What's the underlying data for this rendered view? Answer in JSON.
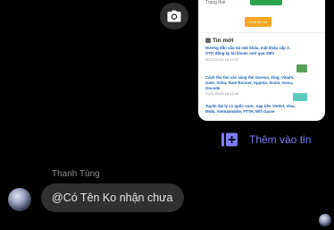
{
  "camera": {
    "icon": "camera-icon"
  },
  "preview": {
    "top_label": "Trạng thái",
    "button_label": "Xuất lịch sử",
    "heading": "Tin mới",
    "items": [
      {
        "title": "Hướng dẫn cấu tài mật khẩu, mật khẩu cấp 2, OTP, đăng ký tài khoản mới qua SMS",
        "date": "2023-03-09 15:12:07"
      },
      {
        "title": "Cách thủ tìm các sàng thẻ Garena, Zing, Vinahi, Gate, Sohu, Rate Runner, Appota, Scoin, Gosu, Oncode",
        "date": "2023-03-09 15:12:06"
      },
      {
        "title": "Tuyển đại lý c1 quốc com.. nạp tiền Viettel, Vina, Mobi, Vietnamobile, FTTH, Wifi Game",
        "date": ""
      }
    ]
  },
  "add_story": {
    "label": "Thêm vào tin",
    "icon": "add-story-icon"
  },
  "message": {
    "sender": "Thanh Tùng",
    "text": "@Có Tên Ko nhận chưa"
  },
  "colors": {
    "background": "#000000",
    "bubble": "#303030",
    "accent": "#7b7cf7"
  }
}
